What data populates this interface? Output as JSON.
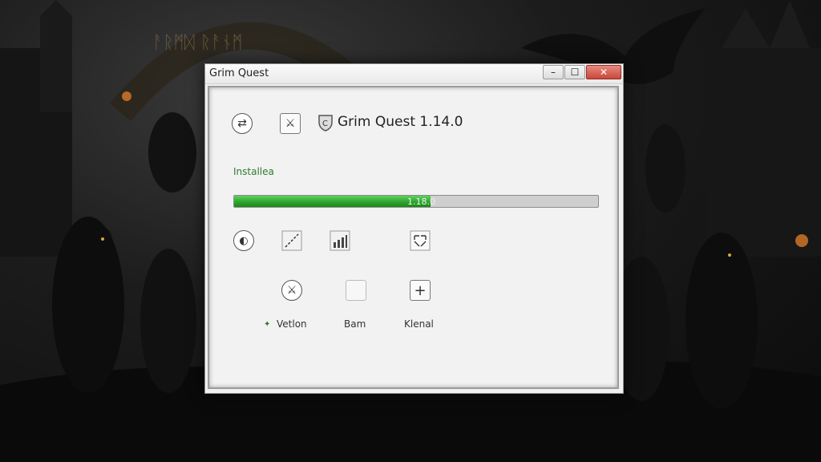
{
  "window": {
    "title": "Grim Quest",
    "minimize_symbol": "–",
    "maximize_symbol": "☐",
    "close_symbol": "✕"
  },
  "header": {
    "app_name": "Grim Quest 1.14.0",
    "icons": [
      "swap-icon",
      "sword-icon",
      "shield-icon"
    ]
  },
  "install": {
    "status_label": "Installea",
    "progress_text": "1.18.0",
    "progress_fraction": 0.54
  },
  "tool_icons": [
    "compass-icon",
    "line-icon",
    "signal-bars-icon",
    "grid-icon"
  ],
  "actions": [
    {
      "name": "Vetlon",
      "icon": "sword-icon",
      "bullet": "✦"
    },
    {
      "name": "Bam",
      "icon": "blank-square-icon"
    },
    {
      "name": "Klenal",
      "icon": "plus-icon"
    }
  ],
  "colors": {
    "progress_green": "#2ea52e",
    "status_green": "#2f7a2f",
    "close_red": "#c8483a"
  }
}
